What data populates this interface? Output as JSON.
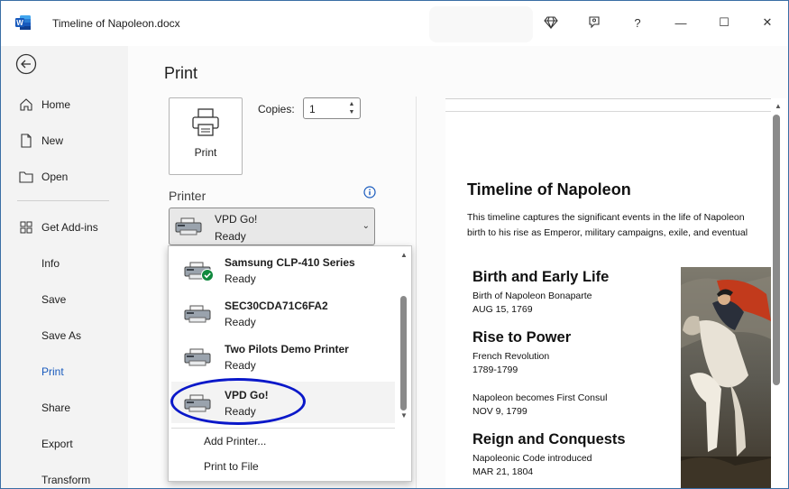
{
  "window": {
    "title": "Timeline of Napoleon.docx",
    "controls": {
      "help": "?",
      "minimize": "—",
      "maximize": "☐",
      "close": "✕"
    }
  },
  "sidebar": {
    "items": [
      {
        "label": "Home",
        "icon": "home-icon"
      },
      {
        "label": "New",
        "icon": "new-document-icon"
      },
      {
        "label": "Open",
        "icon": "folder-icon"
      },
      {
        "label": "Get Add-ins",
        "icon": "add-ins-icon"
      },
      {
        "label": "Info"
      },
      {
        "label": "Save"
      },
      {
        "label": "Save As"
      },
      {
        "label": "Print",
        "active": true
      },
      {
        "label": "Share"
      },
      {
        "label": "Export"
      },
      {
        "label": "Transform"
      }
    ]
  },
  "print": {
    "heading": "Print",
    "button_label": "Print",
    "copies_label": "Copies:",
    "copies_value": "1",
    "printer_heading": "Printer",
    "selected_printer": {
      "name": "VPD Go!",
      "status": "Ready"
    }
  },
  "printer_list": {
    "items": [
      {
        "name": "Samsung CLP-410 Series",
        "status": "Ready",
        "default": true
      },
      {
        "name": "SEC30CDA71C6FA2",
        "status": "Ready"
      },
      {
        "name": "Two Pilots Demo Printer",
        "status": "Ready"
      },
      {
        "name": "VPD Go!",
        "status": "Ready",
        "selected": true
      }
    ],
    "actions": {
      "add_printer": "Add Printer...",
      "print_to_file": "Print to File"
    }
  },
  "preview": {
    "title": "Timeline of Napoleon",
    "intro_line1": "This timeline captures the significant events in the life of Napoleon",
    "intro_line2": "birth to his rise as Emperor, military campaigns, exile, and eventual",
    "sections": [
      {
        "heading": "Birth and Early Life",
        "lines": [
          "Birth of Napoleon Bonaparte",
          "AUG 15, 1769"
        ]
      },
      {
        "heading": "Rise to Power",
        "lines": [
          "French Revolution",
          "1789-1799",
          "Napoleon becomes First Consul",
          "NOV 9, 1799"
        ]
      },
      {
        "heading": "Reign and Conquests",
        "lines": [
          "Napoleonic Code introduced",
          "MAR 21, 1804"
        ]
      }
    ]
  },
  "colors": {
    "accent": "#185abd",
    "highlight_oval": "#0a18c9",
    "word_blue": "#185abd"
  }
}
